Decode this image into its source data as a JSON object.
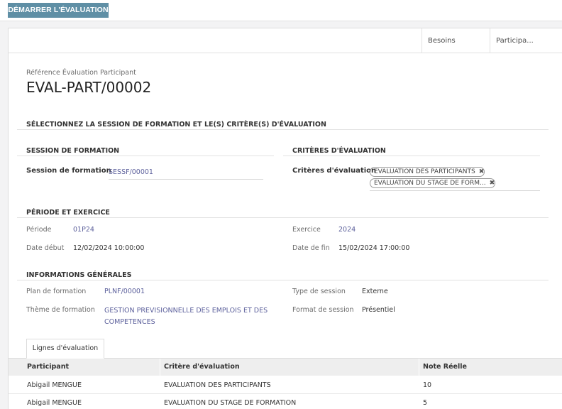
{
  "toolbar": {
    "start_label": "DÉMARRER L'ÉVALUATION"
  },
  "smart_buttons": [
    {
      "label": "Besoins"
    },
    {
      "label": "Participa..."
    }
  ],
  "header": {
    "ref_label": "Référence Évaluation Participant",
    "ref_value": "EVAL-PART/00002"
  },
  "section_main": {
    "title": "SÉLECTIONNEZ LA SESSION DE FORMATION ET LE(S) CRITÈRE(S) D'ÉVALUATION"
  },
  "session": {
    "group_title": "SESSION DE FORMATION",
    "label": "Session de formation",
    "value": "SESSF/00001"
  },
  "criteria": {
    "group_title": "CRITÈRES D'ÉVALUATION",
    "label": "Critères d'évaluation",
    "tags": [
      {
        "text": "EVALUATION DES PARTICIPANTS",
        "remove": "✖"
      },
      {
        "text": "EVALUATION DU STAGE DE FORM...",
        "remove": "✖"
      }
    ]
  },
  "period": {
    "title": "PÉRIODE ET EXERCICE",
    "periode_label": "Période",
    "periode_value": "01P24",
    "exercice_label": "Exercice",
    "exercice_value": "2024",
    "date_debut_label": "Date début",
    "date_debut_value": "12/02/2024 10:00:00",
    "date_fin_label": "Date de fin",
    "date_fin_value": "15/02/2024 17:00:00"
  },
  "general": {
    "title": "INFORMATIONS GÉNÉRALES",
    "plan_label": "Plan de formation",
    "plan_value": "PLNF/00001",
    "theme_label": "Thème de formation",
    "theme_value": "GESTION PREVISIONNELLE DES EMPLOIS ET DES COMPETENCES",
    "type_label": "Type de session",
    "type_value": "Externe",
    "format_label": "Format de session",
    "format_value": "Présentiel"
  },
  "tabs": [
    {
      "label": "Lignes d'évaluation"
    }
  ],
  "table": {
    "headers": [
      "Participant",
      "Critère d'évaluation",
      "Note Réelle"
    ],
    "rows": [
      [
        "Abigail MENGUE",
        "EVALUATION DES PARTICIPANTS",
        "10"
      ],
      [
        "Abigail MENGUE",
        "EVALUATION DU STAGE DE FORMATION",
        "5"
      ]
    ]
  }
}
